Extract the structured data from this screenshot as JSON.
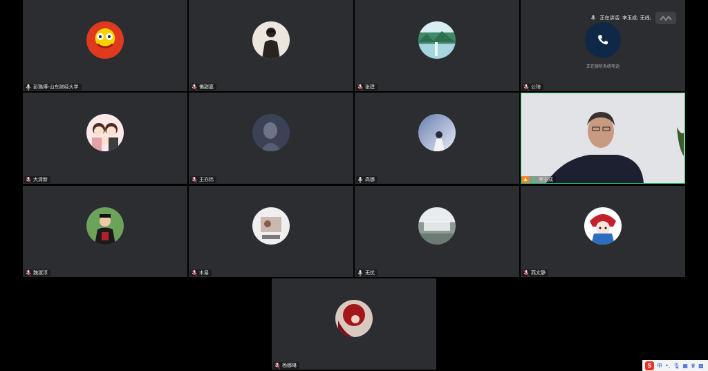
{
  "speaking": {
    "text": "正在讲话: 李玉成; 无线;"
  },
  "participants": [
    {
      "name": "彭璐博-山东财经大学"
    },
    {
      "name": "懒甜嘉"
    },
    {
      "name": "张建"
    },
    {
      "name": "公琦",
      "status": "正在接听系统电话"
    },
    {
      "name": "大清新"
    },
    {
      "name": "王亦炜"
    },
    {
      "name": "高娜"
    },
    {
      "name": "李玉成"
    },
    {
      "name": "魏淑淳"
    },
    {
      "name": "木易"
    },
    {
      "name": "无忧"
    },
    {
      "name": "燕文静"
    },
    {
      "name": "杨娜琳"
    }
  ],
  "ime": {
    "logo": "S",
    "mode": "中"
  },
  "colors": {
    "tile_bg": "#2b2d30",
    "active_border": "#2fbf71",
    "phone_badge": "#0f2847"
  }
}
